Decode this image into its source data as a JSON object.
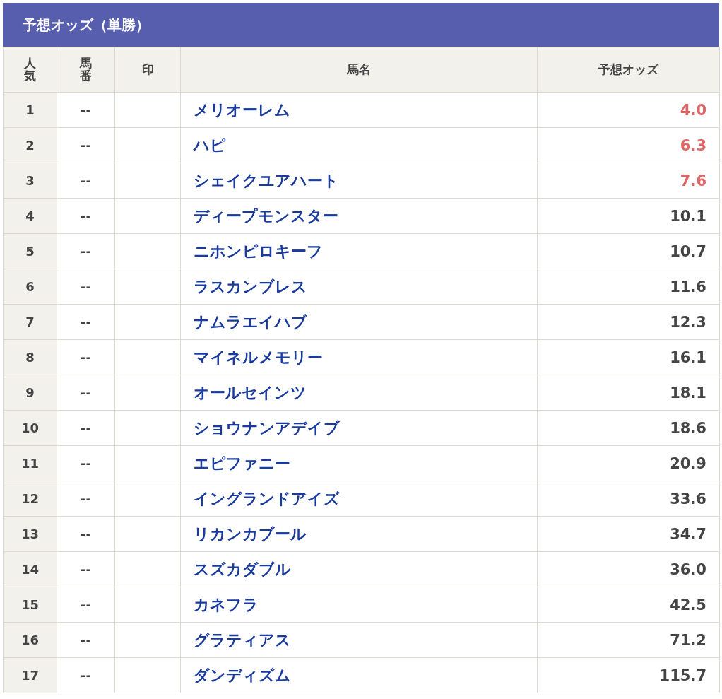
{
  "title": "予想オッズ（単勝）",
  "columns": [
    {
      "label": "人気",
      "kind": "vertical"
    },
    {
      "label": "馬番",
      "kind": "vertical"
    },
    {
      "label": "印",
      "kind": "plain"
    },
    {
      "label": "馬名",
      "kind": "plain"
    },
    {
      "label": "予想オッズ",
      "kind": "plain"
    }
  ],
  "rows": [
    {
      "rank": "1",
      "number": "--",
      "name": "メリオーレム",
      "odds": "4.0",
      "color": "#e06666"
    },
    {
      "rank": "2",
      "number": "--",
      "name": "ハピ",
      "odds": "6.3",
      "color": "#e06666"
    },
    {
      "rank": "3",
      "number": "--",
      "name": "シェイクユアハート",
      "odds": "7.6",
      "color": "#e06666"
    },
    {
      "rank": "4",
      "number": "--",
      "name": "ディープモンスター",
      "odds": "10.1",
      "color": "#444444"
    },
    {
      "rank": "5",
      "number": "--",
      "name": "ニホンピロキーフ",
      "odds": "10.7",
      "color": "#444444"
    },
    {
      "rank": "6",
      "number": "--",
      "name": "ラスカンブレス",
      "odds": "11.6",
      "color": "#444444"
    },
    {
      "rank": "7",
      "number": "--",
      "name": "ナムラエイハブ",
      "odds": "12.3",
      "color": "#444444"
    },
    {
      "rank": "8",
      "number": "--",
      "name": "マイネルメモリー",
      "odds": "16.1",
      "color": "#444444"
    },
    {
      "rank": "9",
      "number": "--",
      "name": "オールセインツ",
      "odds": "18.1",
      "color": "#444444"
    },
    {
      "rank": "10",
      "number": "--",
      "name": "ショウナンアデイブ",
      "odds": "18.6",
      "color": "#444444"
    },
    {
      "rank": "11",
      "number": "--",
      "name": "エピファニー",
      "odds": "20.9",
      "color": "#444444"
    },
    {
      "rank": "12",
      "number": "--",
      "name": "イングランドアイズ",
      "odds": "33.6",
      "color": "#444444"
    },
    {
      "rank": "13",
      "number": "--",
      "name": "リカンカブール",
      "odds": "34.7",
      "color": "#444444"
    },
    {
      "rank": "14",
      "number": "--",
      "name": "スズカダブル",
      "odds": "36.0",
      "color": "#444444"
    },
    {
      "rank": "15",
      "number": "--",
      "name": "カネフラ",
      "odds": "42.5",
      "color": "#444444"
    },
    {
      "rank": "16",
      "number": "--",
      "name": "グラティアス",
      "odds": "71.2",
      "color": "#444444"
    },
    {
      "rank": "17",
      "number": "--",
      "name": "ダンディズム",
      "odds": "115.7",
      "color": "#444444"
    }
  ]
}
